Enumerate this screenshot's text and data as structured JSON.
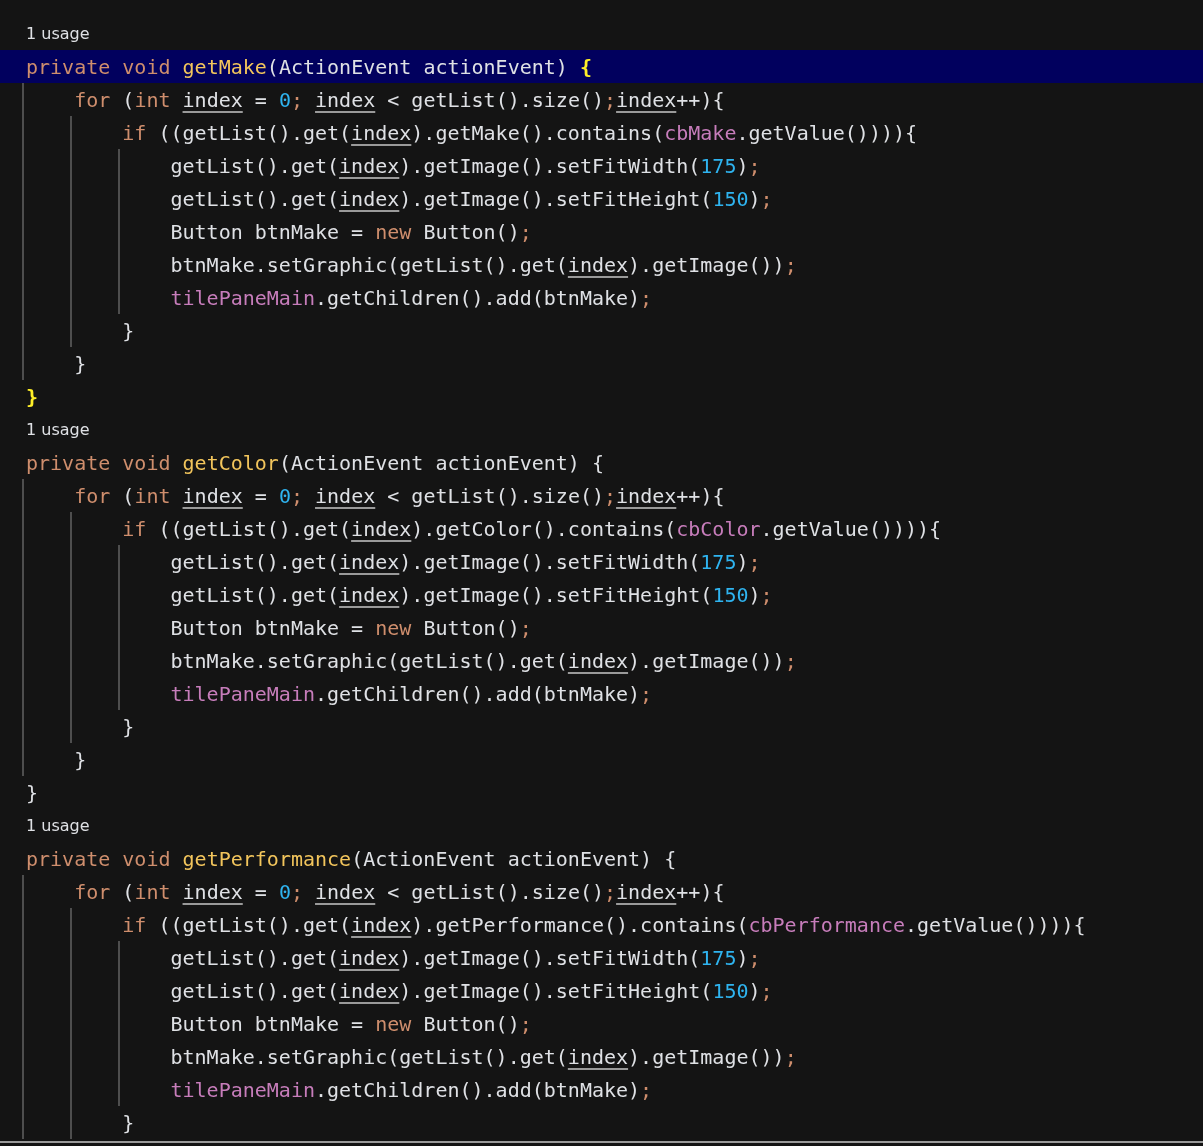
{
  "lines": [
    {
      "kind": "usage",
      "text": "1 usage",
      "highlighted": false
    },
    {
      "kind": "code",
      "highlighted": true,
      "tokens": [
        {
          "t": "private void ",
          "kind": "keyword"
        },
        {
          "t": "getMake",
          "kind": "decl"
        },
        {
          "t": "(ActionEvent actionEvent) ",
          "kind": "plain"
        },
        {
          "t": "{",
          "kind": "match"
        }
      ]
    },
    {
      "kind": "code",
      "highlighted": false,
      "tokens": [
        {
          "t": "    for ",
          "kind": "keyword"
        },
        {
          "t": "(",
          "kind": "plain"
        },
        {
          "t": "int ",
          "kind": "keyword"
        },
        {
          "t": "index",
          "kind": "var"
        },
        {
          "t": " = ",
          "kind": "plain"
        },
        {
          "t": "0",
          "kind": "number"
        },
        {
          "t": "; ",
          "kind": "punct"
        },
        {
          "t": "index",
          "kind": "var"
        },
        {
          "t": " < getList().size()",
          "kind": "plain"
        },
        {
          "t": ";",
          "kind": "punct"
        },
        {
          "t": "index",
          "kind": "var"
        },
        {
          "t": "++){",
          "kind": "plain"
        }
      ]
    },
    {
      "kind": "code",
      "highlighted": false,
      "tokens": [
        {
          "t": "        if ",
          "kind": "keyword"
        },
        {
          "t": "((getList().get(",
          "kind": "plain"
        },
        {
          "t": "index",
          "kind": "var"
        },
        {
          "t": ").getMake().contains(",
          "kind": "plain"
        },
        {
          "t": "cbMake",
          "kind": "field"
        },
        {
          "t": ".getValue()))){",
          "kind": "plain"
        }
      ]
    },
    {
      "kind": "code",
      "highlighted": false,
      "tokens": [
        {
          "t": "            getList().get(",
          "kind": "plain"
        },
        {
          "t": "index",
          "kind": "var"
        },
        {
          "t": ").getImage().setFitWidth(",
          "kind": "plain"
        },
        {
          "t": "175",
          "kind": "number"
        },
        {
          "t": ")",
          "kind": "plain"
        },
        {
          "t": ";",
          "kind": "punct"
        }
      ]
    },
    {
      "kind": "code",
      "highlighted": false,
      "tokens": [
        {
          "t": "            getList().get(",
          "kind": "plain"
        },
        {
          "t": "index",
          "kind": "var"
        },
        {
          "t": ").getImage().setFitHeight(",
          "kind": "plain"
        },
        {
          "t": "150",
          "kind": "number"
        },
        {
          "t": ")",
          "kind": "plain"
        },
        {
          "t": ";",
          "kind": "punct"
        }
      ]
    },
    {
      "kind": "code",
      "highlighted": false,
      "tokens": [
        {
          "t": "            Button btnMake = ",
          "kind": "plain"
        },
        {
          "t": "new ",
          "kind": "keyword"
        },
        {
          "t": "Button()",
          "kind": "plain"
        },
        {
          "t": ";",
          "kind": "punct"
        }
      ]
    },
    {
      "kind": "code",
      "highlighted": false,
      "tokens": [
        {
          "t": "            btnMake.setGraphic(getList().get(",
          "kind": "plain"
        },
        {
          "t": "index",
          "kind": "var"
        },
        {
          "t": ").getImage())",
          "kind": "plain"
        },
        {
          "t": ";",
          "kind": "punct"
        }
      ]
    },
    {
      "kind": "code",
      "highlighted": false,
      "tokens": [
        {
          "t": "            tilePaneMain",
          "kind": "field"
        },
        {
          "t": ".getChildren().add(btnMake)",
          "kind": "plain"
        },
        {
          "t": ";",
          "kind": "punct"
        }
      ]
    },
    {
      "kind": "code",
      "highlighted": false,
      "tokens": [
        {
          "t": "        }",
          "kind": "plain"
        }
      ]
    },
    {
      "kind": "code",
      "highlighted": false,
      "tokens": [
        {
          "t": "    }",
          "kind": "plain"
        }
      ]
    },
    {
      "kind": "code",
      "highlighted": false,
      "tokens": [
        {
          "t": "}",
          "kind": "match"
        }
      ]
    },
    {
      "kind": "usage",
      "text": "1 usage",
      "highlighted": false
    },
    {
      "kind": "code",
      "highlighted": false,
      "tokens": [
        {
          "t": "private void ",
          "kind": "keyword"
        },
        {
          "t": "getColor",
          "kind": "decl"
        },
        {
          "t": "(ActionEvent actionEvent) {",
          "kind": "plain"
        }
      ]
    },
    {
      "kind": "code",
      "highlighted": false,
      "tokens": [
        {
          "t": "    for ",
          "kind": "keyword"
        },
        {
          "t": "(",
          "kind": "plain"
        },
        {
          "t": "int ",
          "kind": "keyword"
        },
        {
          "t": "index",
          "kind": "var"
        },
        {
          "t": " = ",
          "kind": "plain"
        },
        {
          "t": "0",
          "kind": "number"
        },
        {
          "t": "; ",
          "kind": "punct"
        },
        {
          "t": "index",
          "kind": "var"
        },
        {
          "t": " < getList().size()",
          "kind": "plain"
        },
        {
          "t": ";",
          "kind": "punct"
        },
        {
          "t": "index",
          "kind": "var"
        },
        {
          "t": "++){",
          "kind": "plain"
        }
      ]
    },
    {
      "kind": "code",
      "highlighted": false,
      "tokens": [
        {
          "t": "        if ",
          "kind": "keyword"
        },
        {
          "t": "((getList().get(",
          "kind": "plain"
        },
        {
          "t": "index",
          "kind": "var"
        },
        {
          "t": ").getColor().contains(",
          "kind": "plain"
        },
        {
          "t": "cbColor",
          "kind": "field"
        },
        {
          "t": ".getValue()))){",
          "kind": "plain"
        }
      ]
    },
    {
      "kind": "code",
      "highlighted": false,
      "tokens": [
        {
          "t": "            getList().get(",
          "kind": "plain"
        },
        {
          "t": "index",
          "kind": "var"
        },
        {
          "t": ").getImage().setFitWidth(",
          "kind": "plain"
        },
        {
          "t": "175",
          "kind": "number"
        },
        {
          "t": ")",
          "kind": "plain"
        },
        {
          "t": ";",
          "kind": "punct"
        }
      ]
    },
    {
      "kind": "code",
      "highlighted": false,
      "tokens": [
        {
          "t": "            getList().get(",
          "kind": "plain"
        },
        {
          "t": "index",
          "kind": "var"
        },
        {
          "t": ").getImage().setFitHeight(",
          "kind": "plain"
        },
        {
          "t": "150",
          "kind": "number"
        },
        {
          "t": ")",
          "kind": "plain"
        },
        {
          "t": ";",
          "kind": "punct"
        }
      ]
    },
    {
      "kind": "code",
      "highlighted": false,
      "tokens": [
        {
          "t": "            Button btnMake = ",
          "kind": "plain"
        },
        {
          "t": "new ",
          "kind": "keyword"
        },
        {
          "t": "Button()",
          "kind": "plain"
        },
        {
          "t": ";",
          "kind": "punct"
        }
      ]
    },
    {
      "kind": "code",
      "highlighted": false,
      "tokens": [
        {
          "t": "            btnMake.setGraphic(getList().get(",
          "kind": "plain"
        },
        {
          "t": "index",
          "kind": "var"
        },
        {
          "t": ").getImage())",
          "kind": "plain"
        },
        {
          "t": ";",
          "kind": "punct"
        }
      ]
    },
    {
      "kind": "code",
      "highlighted": false,
      "tokens": [
        {
          "t": "            tilePaneMain",
          "kind": "field"
        },
        {
          "t": ".getChildren().add(btnMake)",
          "kind": "plain"
        },
        {
          "t": ";",
          "kind": "punct"
        }
      ]
    },
    {
      "kind": "code",
      "highlighted": false,
      "tokens": [
        {
          "t": "        }",
          "kind": "plain"
        }
      ]
    },
    {
      "kind": "code",
      "highlighted": false,
      "tokens": [
        {
          "t": "    }",
          "kind": "plain"
        }
      ]
    },
    {
      "kind": "code",
      "highlighted": false,
      "tokens": [
        {
          "t": "}",
          "kind": "plain"
        }
      ]
    },
    {
      "kind": "usage",
      "text": "1 usage",
      "highlighted": false
    },
    {
      "kind": "code",
      "highlighted": false,
      "tokens": [
        {
          "t": "private void ",
          "kind": "keyword"
        },
        {
          "t": "getPerformance",
          "kind": "decl"
        },
        {
          "t": "(ActionEvent actionEvent) {",
          "kind": "plain"
        }
      ]
    },
    {
      "kind": "code",
      "highlighted": false,
      "tokens": [
        {
          "t": "    for ",
          "kind": "keyword"
        },
        {
          "t": "(",
          "kind": "plain"
        },
        {
          "t": "int ",
          "kind": "keyword"
        },
        {
          "t": "index",
          "kind": "var"
        },
        {
          "t": " = ",
          "kind": "plain"
        },
        {
          "t": "0",
          "kind": "number"
        },
        {
          "t": "; ",
          "kind": "punct"
        },
        {
          "t": "index",
          "kind": "var"
        },
        {
          "t": " < getList().size()",
          "kind": "plain"
        },
        {
          "t": ";",
          "kind": "punct"
        },
        {
          "t": "index",
          "kind": "var"
        },
        {
          "t": "++){",
          "kind": "plain"
        }
      ]
    },
    {
      "kind": "code",
      "highlighted": false,
      "tokens": [
        {
          "t": "        if ",
          "kind": "keyword"
        },
        {
          "t": "((getList().get(",
          "kind": "plain"
        },
        {
          "t": "index",
          "kind": "var"
        },
        {
          "t": ").getPerformance().contains(",
          "kind": "plain"
        },
        {
          "t": "cbPerformance",
          "kind": "field"
        },
        {
          "t": ".getValue()))){",
          "kind": "plain"
        }
      ]
    },
    {
      "kind": "code",
      "highlighted": false,
      "tokens": [
        {
          "t": "            getList().get(",
          "kind": "plain"
        },
        {
          "t": "index",
          "kind": "var"
        },
        {
          "t": ").getImage().setFitWidth(",
          "kind": "plain"
        },
        {
          "t": "175",
          "kind": "number"
        },
        {
          "t": ")",
          "kind": "plain"
        },
        {
          "t": ";",
          "kind": "punct"
        }
      ]
    },
    {
      "kind": "code",
      "highlighted": false,
      "tokens": [
        {
          "t": "            getList().get(",
          "kind": "plain"
        },
        {
          "t": "index",
          "kind": "var"
        },
        {
          "t": ").getImage().setFitHeight(",
          "kind": "plain"
        },
        {
          "t": "150",
          "kind": "number"
        },
        {
          "t": ")",
          "kind": "plain"
        },
        {
          "t": ";",
          "kind": "punct"
        }
      ]
    },
    {
      "kind": "code",
      "highlighted": false,
      "tokens": [
        {
          "t": "            Button btnMake = ",
          "kind": "plain"
        },
        {
          "t": "new ",
          "kind": "keyword"
        },
        {
          "t": "Button()",
          "kind": "plain"
        },
        {
          "t": ";",
          "kind": "punct"
        }
      ]
    },
    {
      "kind": "code",
      "highlighted": false,
      "tokens": [
        {
          "t": "            btnMake.setGraphic(getList().get(",
          "kind": "plain"
        },
        {
          "t": "index",
          "kind": "var"
        },
        {
          "t": ").getImage())",
          "kind": "plain"
        },
        {
          "t": ";",
          "kind": "punct"
        }
      ]
    },
    {
      "kind": "code",
      "highlighted": false,
      "tokens": [
        {
          "t": "            tilePaneMain",
          "kind": "field"
        },
        {
          "t": ".getChildren().add(btnMake)",
          "kind": "plain"
        },
        {
          "t": ";",
          "kind": "punct"
        }
      ]
    },
    {
      "kind": "code",
      "highlighted": false,
      "tokens": [
        {
          "t": "        }",
          "kind": "plain"
        }
      ]
    }
  ]
}
